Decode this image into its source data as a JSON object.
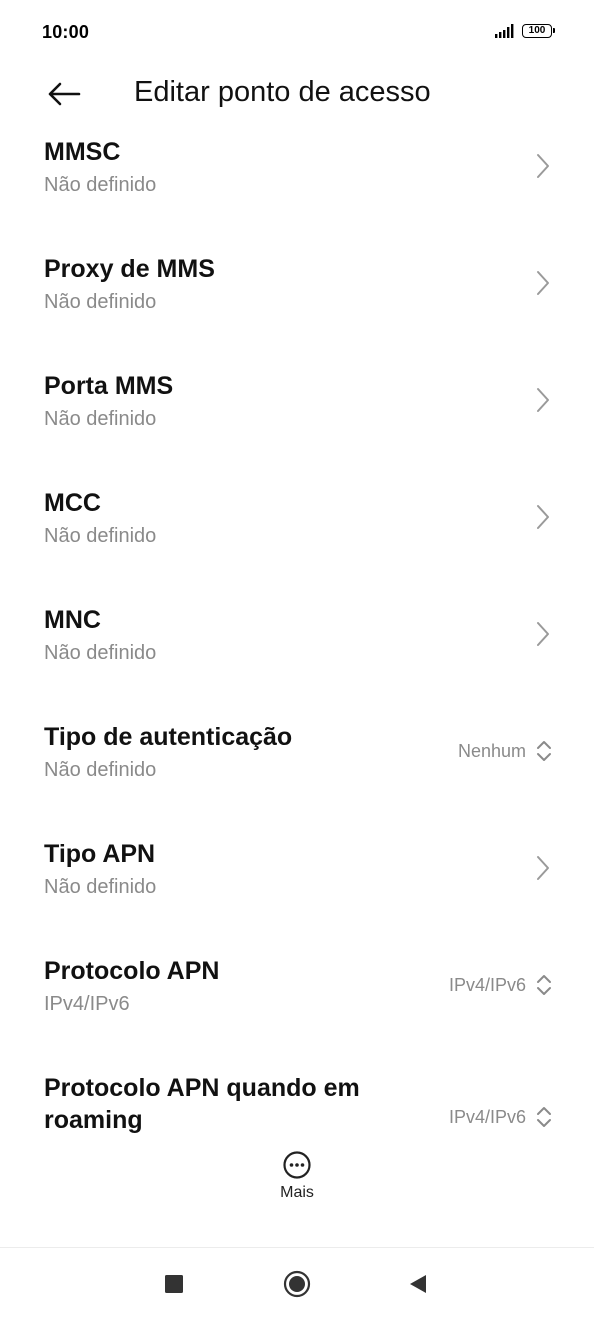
{
  "status_bar": {
    "time": "10:00",
    "battery": "100",
    "icons": [
      "signal-icon",
      "battery-icon"
    ]
  },
  "header": {
    "title": "Editar ponto de acesso",
    "back_icon": "arrow-left-icon"
  },
  "settings": [
    {
      "title": "MMSC",
      "subtitle": "Não definido",
      "control": "chevron"
    },
    {
      "title": "Proxy de MMS",
      "subtitle": "Não definido",
      "control": "chevron"
    },
    {
      "title": "Porta MMS",
      "subtitle": "Não definido",
      "control": "chevron"
    },
    {
      "title": "MCC",
      "subtitle": "Não definido",
      "control": "chevron"
    },
    {
      "title": "MNC",
      "subtitle": "Não definido",
      "control": "chevron"
    },
    {
      "title": "Tipo de autenticação",
      "subtitle": "Não definido",
      "control": "dropdown",
      "value": "Nenhum"
    },
    {
      "title": "Tipo APN",
      "subtitle": "Não definido",
      "control": "chevron"
    },
    {
      "title": "Protocolo APN",
      "subtitle": "IPv4/IPv6",
      "control": "dropdown",
      "value": "IPv4/IPv6"
    },
    {
      "title_line1": "Protocolo APN quando em",
      "title_line2": "roaming",
      "control": "dropdown",
      "value": "IPv4/IPv6"
    }
  ],
  "bottom_action": {
    "label": "Mais",
    "icon": "more-dots-icon"
  },
  "nav_bar": {
    "icons": [
      "recent-apps-icon",
      "home-icon",
      "back-triangle-icon"
    ]
  },
  "colors": {
    "subtitle": "#8a8a8a",
    "title": "#111111",
    "background": "#ffffff"
  }
}
